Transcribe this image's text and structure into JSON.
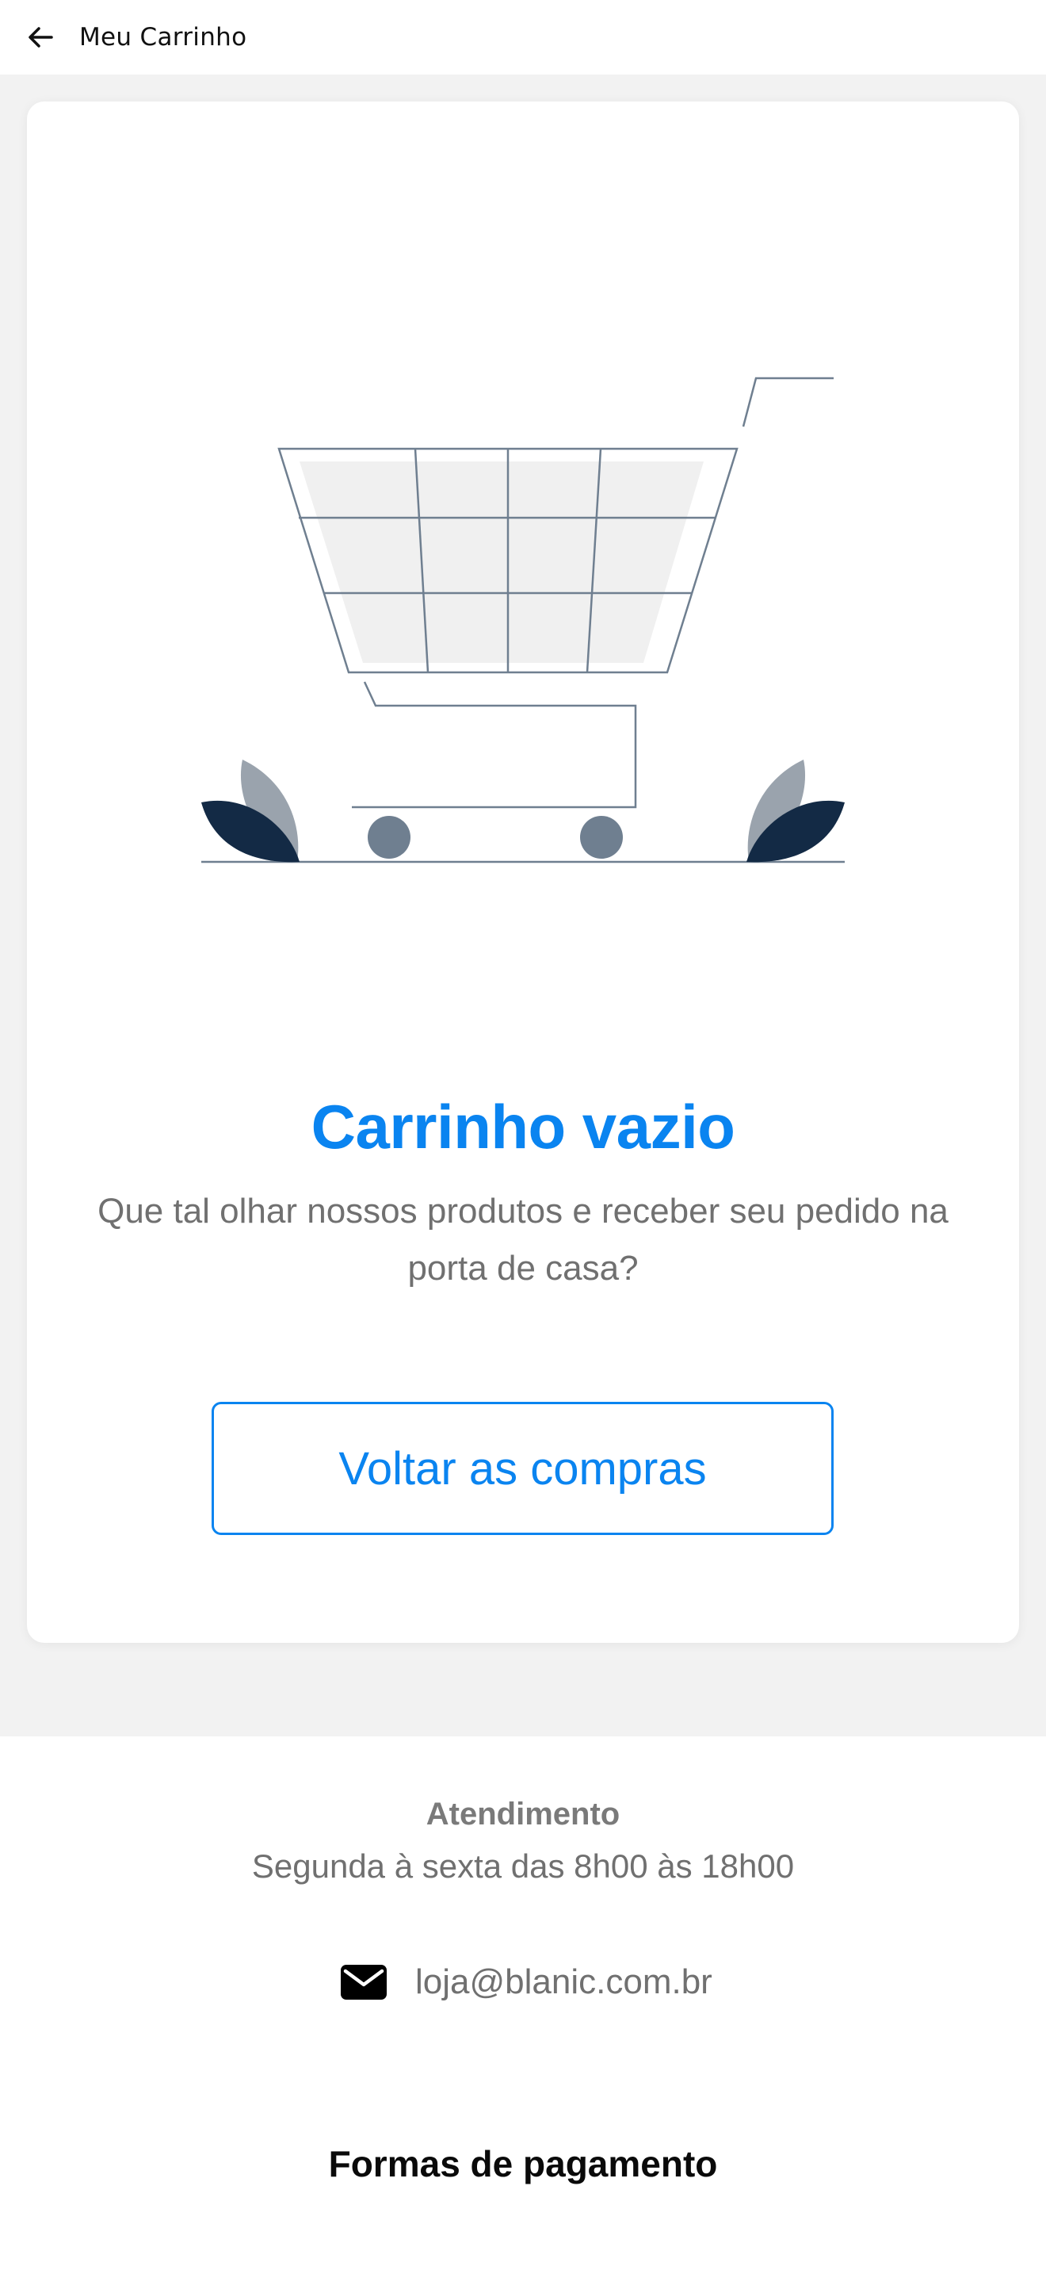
{
  "header": {
    "title": "Meu Carrinho",
    "back_icon": "arrow-left-icon"
  },
  "empty_state": {
    "illustration_icon": "shopping-cart-illustration",
    "title": "Carrinho vazio",
    "subtitle": "Que tal olhar nossos produtos e receber seu pedido na porta de casa?",
    "button_label": "Voltar as compras"
  },
  "footer": {
    "support_heading": "Atendimento",
    "support_hours": "Segunda à sexta das 8h00 às 18h00",
    "email_icon": "mail-icon",
    "email": "loja@blanic.com.br",
    "payment_heading": "Formas de pagamento"
  },
  "colors": {
    "accent": "#0a84f0",
    "text_muted": "#707070",
    "leaf_dark": "#132a45",
    "leaf_light": "#9aa3ad",
    "wheel": "#6f7f90",
    "line": "#6f7f90"
  }
}
